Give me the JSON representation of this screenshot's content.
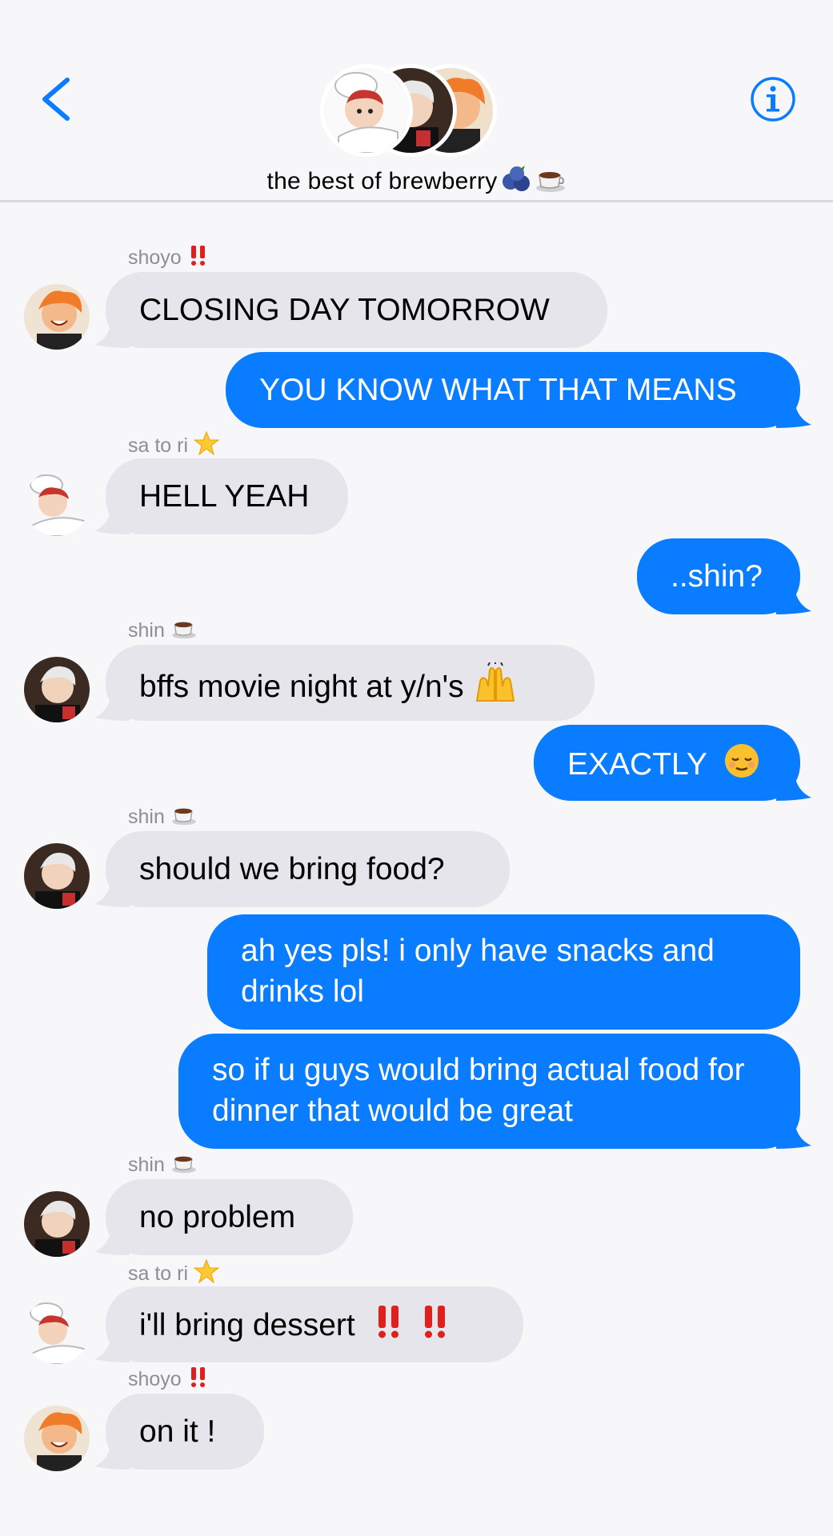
{
  "header": {
    "back_icon": "chevron-left-icon",
    "info_icon": "info-circle-icon",
    "group_name": "the best of brewberry",
    "group_emojis": [
      "blueberry-icon",
      "coffee-icon"
    ],
    "accent_color": "#0a7cff"
  },
  "thread": {
    "messages": [
      {
        "from": "shoyo",
        "sender_label": "shoyo",
        "sender_emoji": "double-exclamation-icon",
        "direction": "in",
        "text": "CLOSING DAY TOMORROW"
      },
      {
        "direction": "out",
        "text": "YOU KNOW WHAT THAT MEANS"
      },
      {
        "from": "sa to ri",
        "sender_label": "sa to ri",
        "sender_emoji": "glowing-star-icon",
        "direction": "in",
        "text": "HELL YEAH"
      },
      {
        "direction": "out",
        "text": "..shin?"
      },
      {
        "from": "shin",
        "sender_label": "shin",
        "sender_emoji": "coffee-icon",
        "direction": "in",
        "text": "bffs movie night at y/n's",
        "trailing_emoji": "raising-hands-icon"
      },
      {
        "direction": "out",
        "text": "EXACTLY",
        "trailing_emoji": "relieved-face-icon"
      },
      {
        "from": "shin",
        "sender_label": "shin",
        "sender_emoji": "coffee-icon",
        "direction": "in",
        "text": "should we bring food?"
      },
      {
        "direction": "out",
        "text": "ah yes pls! i only have snacks and drinks lol"
      },
      {
        "direction": "out",
        "text": "so if u guys would bring actual food for dinner that would be great"
      },
      {
        "from": "shin",
        "sender_label": "shin",
        "sender_emoji": "coffee-icon",
        "direction": "in",
        "text": "no problem"
      },
      {
        "from": "sa to ri",
        "sender_label": "sa to ri",
        "sender_emoji": "glowing-star-icon",
        "direction": "in",
        "text": "i'll bring dessert",
        "trailing_emoji": "double-exclamation-icon x2"
      },
      {
        "from": "shoyo",
        "sender_label": "shoyo",
        "sender_emoji": "double-exclamation-icon",
        "direction": "in",
        "text": "on it !"
      }
    ]
  },
  "colors": {
    "incoming_bubble": "#e6e5eb",
    "outgoing_bubble": "#0a7cff",
    "background": "#f7f7f9",
    "sender_label": "#8e8e93"
  }
}
